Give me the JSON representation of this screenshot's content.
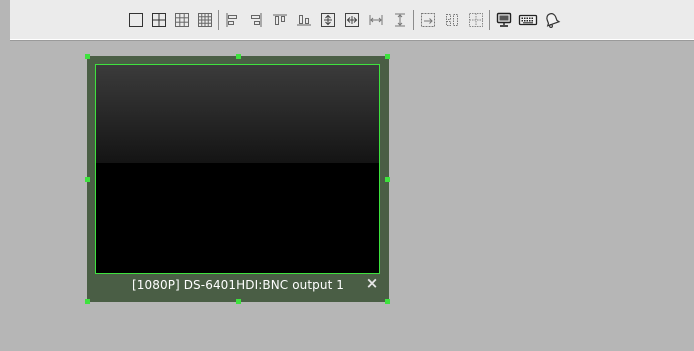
{
  "toolbar": {
    "icons": [
      "single-screen-icon",
      "split-4-icon",
      "split-9-icon",
      "split-16-icon",
      "align-left-icon",
      "align-right-icon",
      "align-top-icon",
      "align-bottom-icon",
      "center-vertical-icon",
      "center-horizontal-icon",
      "equal-width-icon",
      "equal-height-icon",
      "merge-icon",
      "split-icon",
      "grid-icon",
      "monitor-icon",
      "keyboard-icon",
      "bell-icon"
    ]
  },
  "window": {
    "caption": "[1080P] DS-6401HDI:BNC output 1",
    "close_symbol": "×"
  },
  "colors": {
    "toolbar_bg": "#ebebeb",
    "canvas_bg": "#b6b6b6",
    "window_frame": "#4a5e45",
    "selection_green": "#3ee23e",
    "video_bg": "#000000",
    "caption_text": "#ffffff"
  }
}
